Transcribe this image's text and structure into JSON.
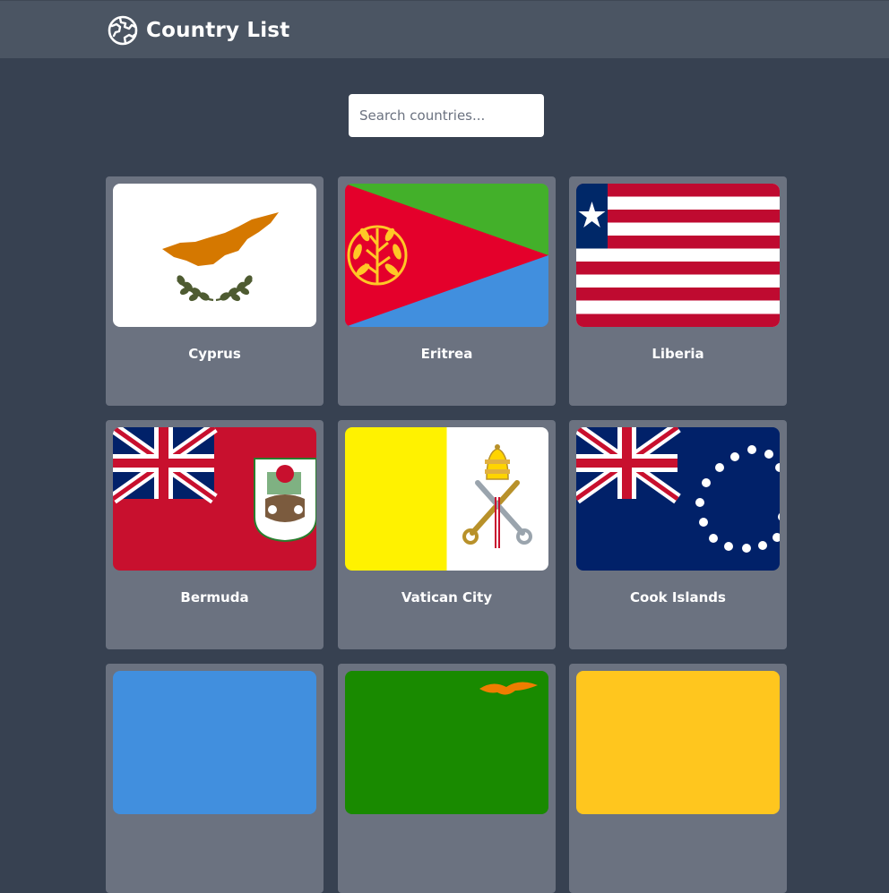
{
  "header": {
    "title": "Country List",
    "logo_icon": "globe-icon"
  },
  "search": {
    "placeholder": "Search countries...",
    "value": ""
  },
  "countries": [
    {
      "name": "Cyprus",
      "flag_icon": "cyprus-flag-icon"
    },
    {
      "name": "Eritrea",
      "flag_icon": "eritrea-flag-icon"
    },
    {
      "name": "Liberia",
      "flag_icon": "liberia-flag-icon"
    },
    {
      "name": "Bermuda",
      "flag_icon": "bermuda-flag-icon"
    },
    {
      "name": "Vatican City",
      "flag_icon": "vatican-flag-icon"
    },
    {
      "name": "Cook Islands",
      "flag_icon": "cook-islands-flag-icon"
    },
    {
      "name": "",
      "flag_icon": "blue-flag-icon"
    },
    {
      "name": "",
      "flag_icon": "zambia-flag-icon"
    },
    {
      "name": "",
      "flag_icon": "yellow-flag-icon"
    }
  ],
  "colors": {
    "background": "#374151",
    "navbar": "#4b5563",
    "card": "#6b7280",
    "text": "#ffffff"
  }
}
